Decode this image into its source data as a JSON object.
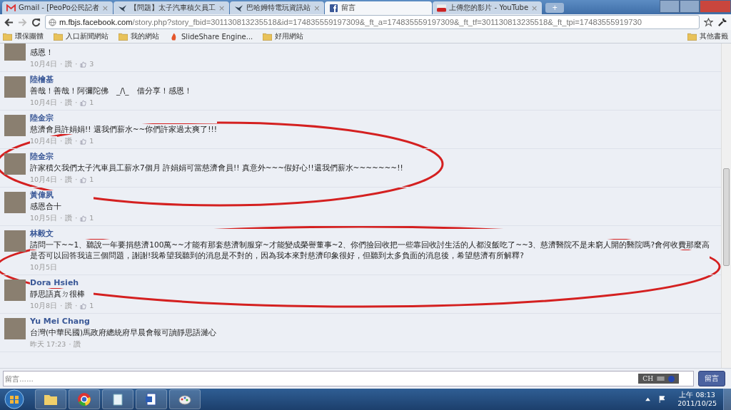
{
  "browser": {
    "tabs": [
      {
        "label": "Gmail - [PeoPo公民記者",
        "kind": "gmail",
        "close": "×",
        "selected": false
      },
      {
        "label": "【問題】太子汽車積欠員工",
        "kind": "bird",
        "close": "×",
        "selected": false
      },
      {
        "label": "巴哈姆特電玩資訊站",
        "kind": "bird",
        "close": "×",
        "selected": false
      },
      {
        "label": "留言",
        "kind": "facebook",
        "selected": true
      },
      {
        "label": "上傳您的影片 - YouTube",
        "kind": "youtube",
        "close": "×",
        "selected": false
      }
    ],
    "new_tab": "+",
    "url_host": "m.fbjs.facebook.com",
    "url_path": "/story.php?story_fbid=301130813235518&id=174835559197309&_ft_a=174835559197309&_ft_tf=301130813235518&_ft_tpi=17483555919730",
    "bookmarks": [
      {
        "label": "環保團體",
        "kind": "folder"
      },
      {
        "label": "入口新聞網站",
        "kind": "folder"
      },
      {
        "label": "我的網站",
        "kind": "folder"
      },
      {
        "label": "SlideShare Engine...",
        "kind": "flame"
      },
      {
        "label": "好用網站",
        "kind": "folder"
      }
    ],
    "other_bookmarks": "其他書籤"
  },
  "comments": [
    {
      "text": "感恩！",
      "date": "10月4日",
      "sep": "·",
      "like": "讚",
      "sep2": "·",
      "likes": "3"
    },
    {
      "name": "陸檜基",
      "text": "善哉！善哉！阿彌陀佛　_/\\_　借分享！感恩！",
      "date": "10月4日",
      "sep": "·",
      "like": "讚",
      "sep2": "·",
      "likes": "1"
    },
    {
      "name": "陸金宗",
      "text": "慈濟會員許娟娟!! 還我們薪水~~你們許家過太爽了!!!",
      "date": "10月4日",
      "sep": "·",
      "like": "讚",
      "sep2": "·",
      "likes": "1"
    },
    {
      "name": "陸金宗",
      "text": "許家積欠我們太子汽車員工薪水7個月 許娟娟可當慈濟會員!! 真意外~~~假好心!!還我們薪水~~~~~~~!!",
      "date": "10月4日",
      "sep": "·",
      "like": "讚",
      "sep2": "·",
      "likes": "1"
    },
    {
      "name": "黃偉夙",
      "text": "感恩合十",
      "date": "10月5日",
      "sep": "·",
      "like": "讚",
      "sep2": "·",
      "likes": "1"
    },
    {
      "name": "林毅文",
      "lines": [
        "請問一下~~1、聽說一年要捐慈濟100萬~~才能有那套慈濟制服穿~才能變成榮譽董事~2、你們撿回收把一些靠回收討生活的人都沒飯吃了~~3、慈濟醫院不是未窮人開的醫院嗎?會何收費那麼高",
        "是否可以回答我這三個問題，謝謝!我希望我聽到的消息是不對的，因為我本來對慈濟印象很好，但聽到太多負面的消息後，希望慈濟有所解釋?"
      ],
      "date": "10月5日"
    },
    {
      "name": "Dora Hsieh",
      "text": "靜思語真ㄉ很棒",
      "date": "10月8日",
      "sep": "·",
      "like": "讚",
      "sep2": "·",
      "likes": "1"
    },
    {
      "name": "Yu Mei Chang",
      "text": "台灣(中華民國)馬政府總統府早晨會報可讀靜思語濰心",
      "date": "昨天 17:23",
      "sep": "·",
      "like": "讚"
    }
  ],
  "composer": {
    "placeholder": "留言……",
    "ime": "CH",
    "button": "留言"
  },
  "annotations": [
    {
      "kind": "ellipse",
      "color": "#d42020"
    },
    {
      "kind": "ellipse",
      "color": "#d42020"
    }
  ],
  "taskbar": {
    "apps": [
      {
        "kind": "folder"
      },
      {
        "kind": "chrome"
      },
      {
        "kind": "notepad"
      },
      {
        "kind": "word"
      },
      {
        "kind": "paint"
      }
    ],
    "time": "上午 08:13",
    "date": "2011/10/25"
  }
}
